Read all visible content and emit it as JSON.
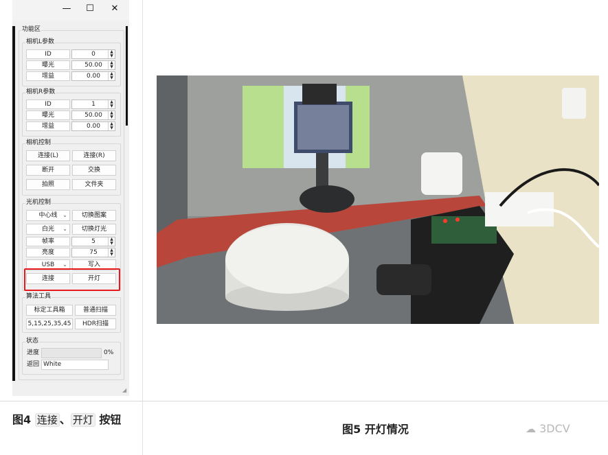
{
  "window": {
    "min_glyph": "—",
    "max_glyph": "☐",
    "close_glyph": "✕"
  },
  "panel": {
    "title": "功能区",
    "cameraL": {
      "title": "相机L参数",
      "rows": [
        {
          "label": "ID",
          "value": "0"
        },
        {
          "label": "曝光",
          "value": "50.00"
        },
        {
          "label": "增益",
          "value": "0.00"
        }
      ]
    },
    "cameraR": {
      "title": "相机R参数",
      "rows": [
        {
          "label": "ID",
          "value": "1"
        },
        {
          "label": "曝光",
          "value": "50.00"
        },
        {
          "label": "增益",
          "value": "0.00"
        }
      ]
    },
    "camctrl": {
      "title": "相机控制",
      "connect_l": "连接(L)",
      "connect_r": "连接(R)",
      "disconnect": "断开",
      "swap": "交换",
      "capture": "拍照",
      "folder": "文件夹"
    },
    "projctrl": {
      "title": "光机控制",
      "pattern_select": "中心线",
      "switch_pattern": "切换图案",
      "light_select": "白光",
      "switch_light": "切换灯光",
      "framerate_label": "帧率",
      "framerate_value": "5",
      "brightness_label": "亮度",
      "brightness_value": "75",
      "interface_select": "USB",
      "write": "写入",
      "connect": "连接",
      "light_on": "开灯"
    },
    "algo": {
      "title": "算法工具",
      "calib": "标定工具箱",
      "normal_scan": "普通扫描",
      "exposures": "5,15,25,35,45",
      "hdr_scan": "HDR扫描"
    },
    "status": {
      "title": "状态",
      "progress_label": "进度",
      "progress": 0,
      "progress_text": "0%",
      "return_label": "返回",
      "return_value": "White"
    }
  },
  "captions": {
    "fig4_prefix": "图4 ",
    "fig4_chip1": "连接",
    "fig4_sep": "、",
    "fig4_chip2": "开灯",
    "fig4_suffix": " 按钮",
    "fig5": "图5 开灯情况",
    "watermark": "3DCV"
  },
  "colors": {
    "highlight_box": "#e8191c",
    "panel_bg": "#f0f0f0"
  }
}
